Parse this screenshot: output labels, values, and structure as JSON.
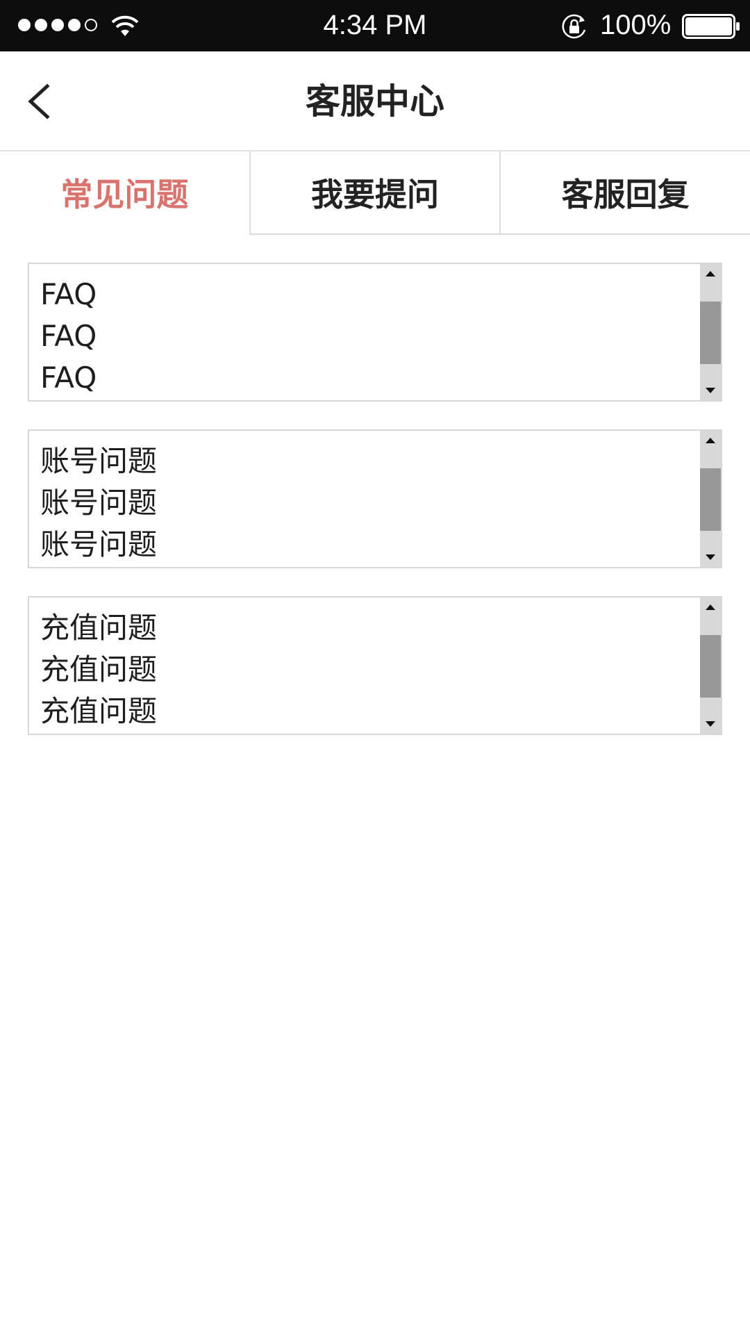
{
  "status_bar": {
    "time": "4:34 PM",
    "battery_percent": "100%",
    "signal_bars_filled": 4,
    "signal_bars_total": 5,
    "battery_level": 1.0
  },
  "nav": {
    "title": "客服中心",
    "back_icon": "chevron-left-icon"
  },
  "tabs": [
    {
      "label": "常见问题",
      "active": true
    },
    {
      "label": "我要提问",
      "active": false
    },
    {
      "label": "客服回复",
      "active": false
    }
  ],
  "colors": {
    "accent": "#d9736e",
    "status_bar_bg": "#0d0d0d",
    "text": "#222222"
  },
  "lists": [
    {
      "name": "faq",
      "items": [
        "FAQ",
        "FAQ",
        "FAQ"
      ]
    },
    {
      "name": "account",
      "items": [
        "账号问题",
        "账号问题",
        "账号问题"
      ]
    },
    {
      "name": "recharge",
      "items": [
        "充值问题",
        "充值问题",
        "充值问题"
      ]
    }
  ]
}
